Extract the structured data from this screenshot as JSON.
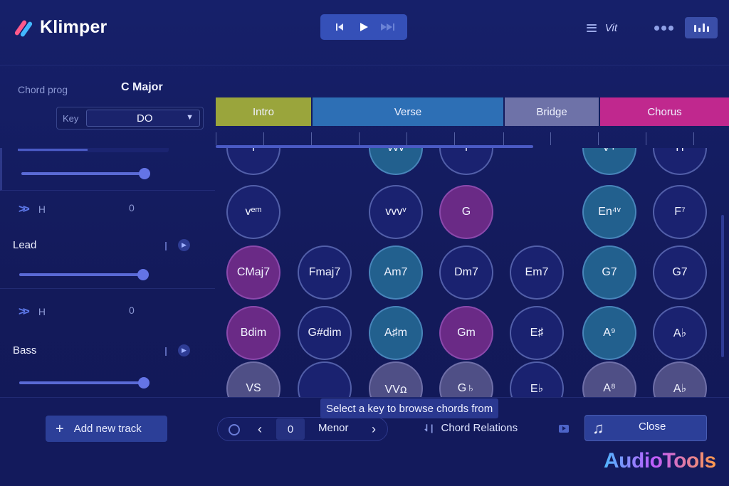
{
  "app": {
    "name": "Klimper"
  },
  "header": {
    "menu_label": "Vit",
    "colors": {
      "transport": "#3550b8",
      "eq": "#3a4ea8"
    }
  },
  "left_panel": {
    "chord_prog_label": "Chord prog",
    "scale_name": "C Major",
    "key_label": "Key",
    "key_value": "DO"
  },
  "tracks": [
    {
      "h_label": "H",
      "value": "0",
      "name": "Lead",
      "level": 0.86
    },
    {
      "h_label": "H",
      "value": "0",
      "name": "Bass",
      "level": 0.87
    }
  ],
  "sections": [
    {
      "label": "Intro",
      "color": "#9aa53c"
    },
    {
      "label": "Verse",
      "color": "#2d6fb5"
    },
    {
      "label": "Bridge",
      "color": "#6e72a8"
    },
    {
      "label": "Chorus",
      "color": "#c0288e"
    }
  ],
  "chord_rows": [
    {
      "chords": [
        {
          "label": "I",
          "style": "dark"
        },
        {
          "label": "",
          "style": "empty"
        },
        {
          "label": "vvv",
          "style": "teal"
        },
        {
          "label": "I",
          "style": "dark"
        },
        {
          "label": "",
          "style": "empty"
        },
        {
          "label": "V+",
          "style": "teal"
        },
        {
          "label": "H",
          "style": "dark"
        }
      ]
    },
    {
      "chords": [
        {
          "label": "vᵉᵐ",
          "style": "dark"
        },
        {
          "label": "",
          "style": "empty"
        },
        {
          "label": "vvvᵛ",
          "style": "dark"
        },
        {
          "label": "G",
          "style": "purple"
        },
        {
          "label": "",
          "style": "empty"
        },
        {
          "label": "En⁴ᵛ",
          "style": "teal"
        },
        {
          "label": "F⁷",
          "style": "dark"
        }
      ]
    },
    {
      "chords": [
        {
          "label": "CMaj7",
          "style": "purple"
        },
        {
          "label": "Fmaj7",
          "style": "dark"
        },
        {
          "label": "Am7",
          "style": "teal"
        },
        {
          "label": "Dm7",
          "style": "dark"
        },
        {
          "label": "Em7",
          "style": "dark"
        },
        {
          "label": "G7",
          "style": "teal"
        },
        {
          "label": "G7",
          "style": "dark"
        }
      ]
    },
    {
      "chords": [
        {
          "label": "Bdim",
          "style": "purple"
        },
        {
          "label": "G#dim",
          "style": "dark"
        },
        {
          "label": "A♯m",
          "style": "teal"
        },
        {
          "label": "Gm",
          "style": "purple"
        },
        {
          "label": "E♯",
          "style": "dark"
        },
        {
          "label": "A⁹",
          "style": "teal"
        },
        {
          "label": "A♭",
          "style": "dark"
        }
      ]
    },
    {
      "chords": [
        {
          "label": "VS",
          "style": "gray"
        },
        {
          "label": "",
          "style": "dark"
        },
        {
          "label": "VVꭥ",
          "style": "gray"
        },
        {
          "label": "G♄",
          "style": "gray"
        },
        {
          "label": "E♭",
          "style": "dark"
        },
        {
          "label": "A⁸",
          "style": "gray"
        },
        {
          "label": "A♭",
          "style": "gray"
        }
      ]
    }
  ],
  "footer": {
    "add_track_label": "Add new track",
    "browser_value": "0",
    "browser_mode": "Menor",
    "tooltip": "Select a key to browse chords from",
    "chord_relations_label": "Chord Relations",
    "close_label": "Close",
    "watermark": "AudioTools"
  }
}
